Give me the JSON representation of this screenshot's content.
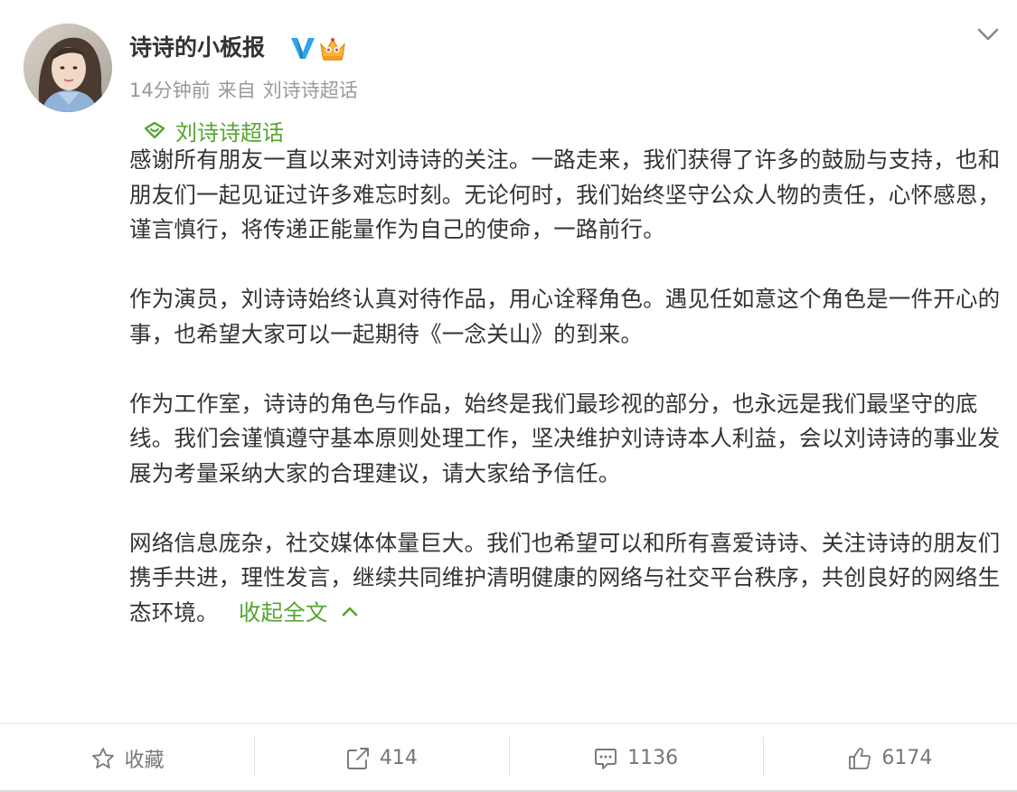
{
  "user": {
    "name": "诗诗的小板报",
    "avatar": "avatar-photo",
    "badges": [
      "verified-v-icon",
      "crown-icon"
    ]
  },
  "meta": {
    "time": "14分钟前",
    "source_prefix": "来自",
    "source": "刘诗诗超话"
  },
  "topic": {
    "icon": "supertopic-icon",
    "label": "刘诗诗超话"
  },
  "content": {
    "paragraphs": [
      "感谢所有朋友一直以来对刘诗诗的关注。一路走来，我们获得了许多的鼓励与支持，也和朋友们一起见证过许多难忘时刻。无论何时，我们始终坚守公众人物的责任，心怀感恩，谨言慎行，将传递正能量作为自己的使命，一路前行。",
      "作为演员，刘诗诗始终认真对待作品，用心诠释角色。遇见任如意这个角色是一件开心的事，也希望大家可以一起期待《一念关山》的到来。",
      "作为工作室，诗诗的角色与作品，始终是我们最珍视的部分，也永远是我们最坚守的底线。我们会谨慎遵守基本原则处理工作，坚决维护刘诗诗本人利益，会以刘诗诗的事业发展为考量采纳大家的合理建议，请大家给予信任。",
      "网络信息庞杂，社交媒体体量巨大。我们也希望可以和所有喜爱诗诗、关注诗诗的朋友们携手共进，理性发言，继续共同维护清明健康的网络与社交平台秩序，共创良好的网络生态环境。"
    ],
    "collapse_label": "收起全文"
  },
  "toolbar": {
    "favorite_label": "收藏",
    "repost_count": "414",
    "comment_count": "1136",
    "like_count": "6174"
  },
  "colors": {
    "accent": "#55a531",
    "text": "#333333",
    "meta": "#999999",
    "verified": "#f5a623",
    "toolbar_text": "#777777"
  }
}
